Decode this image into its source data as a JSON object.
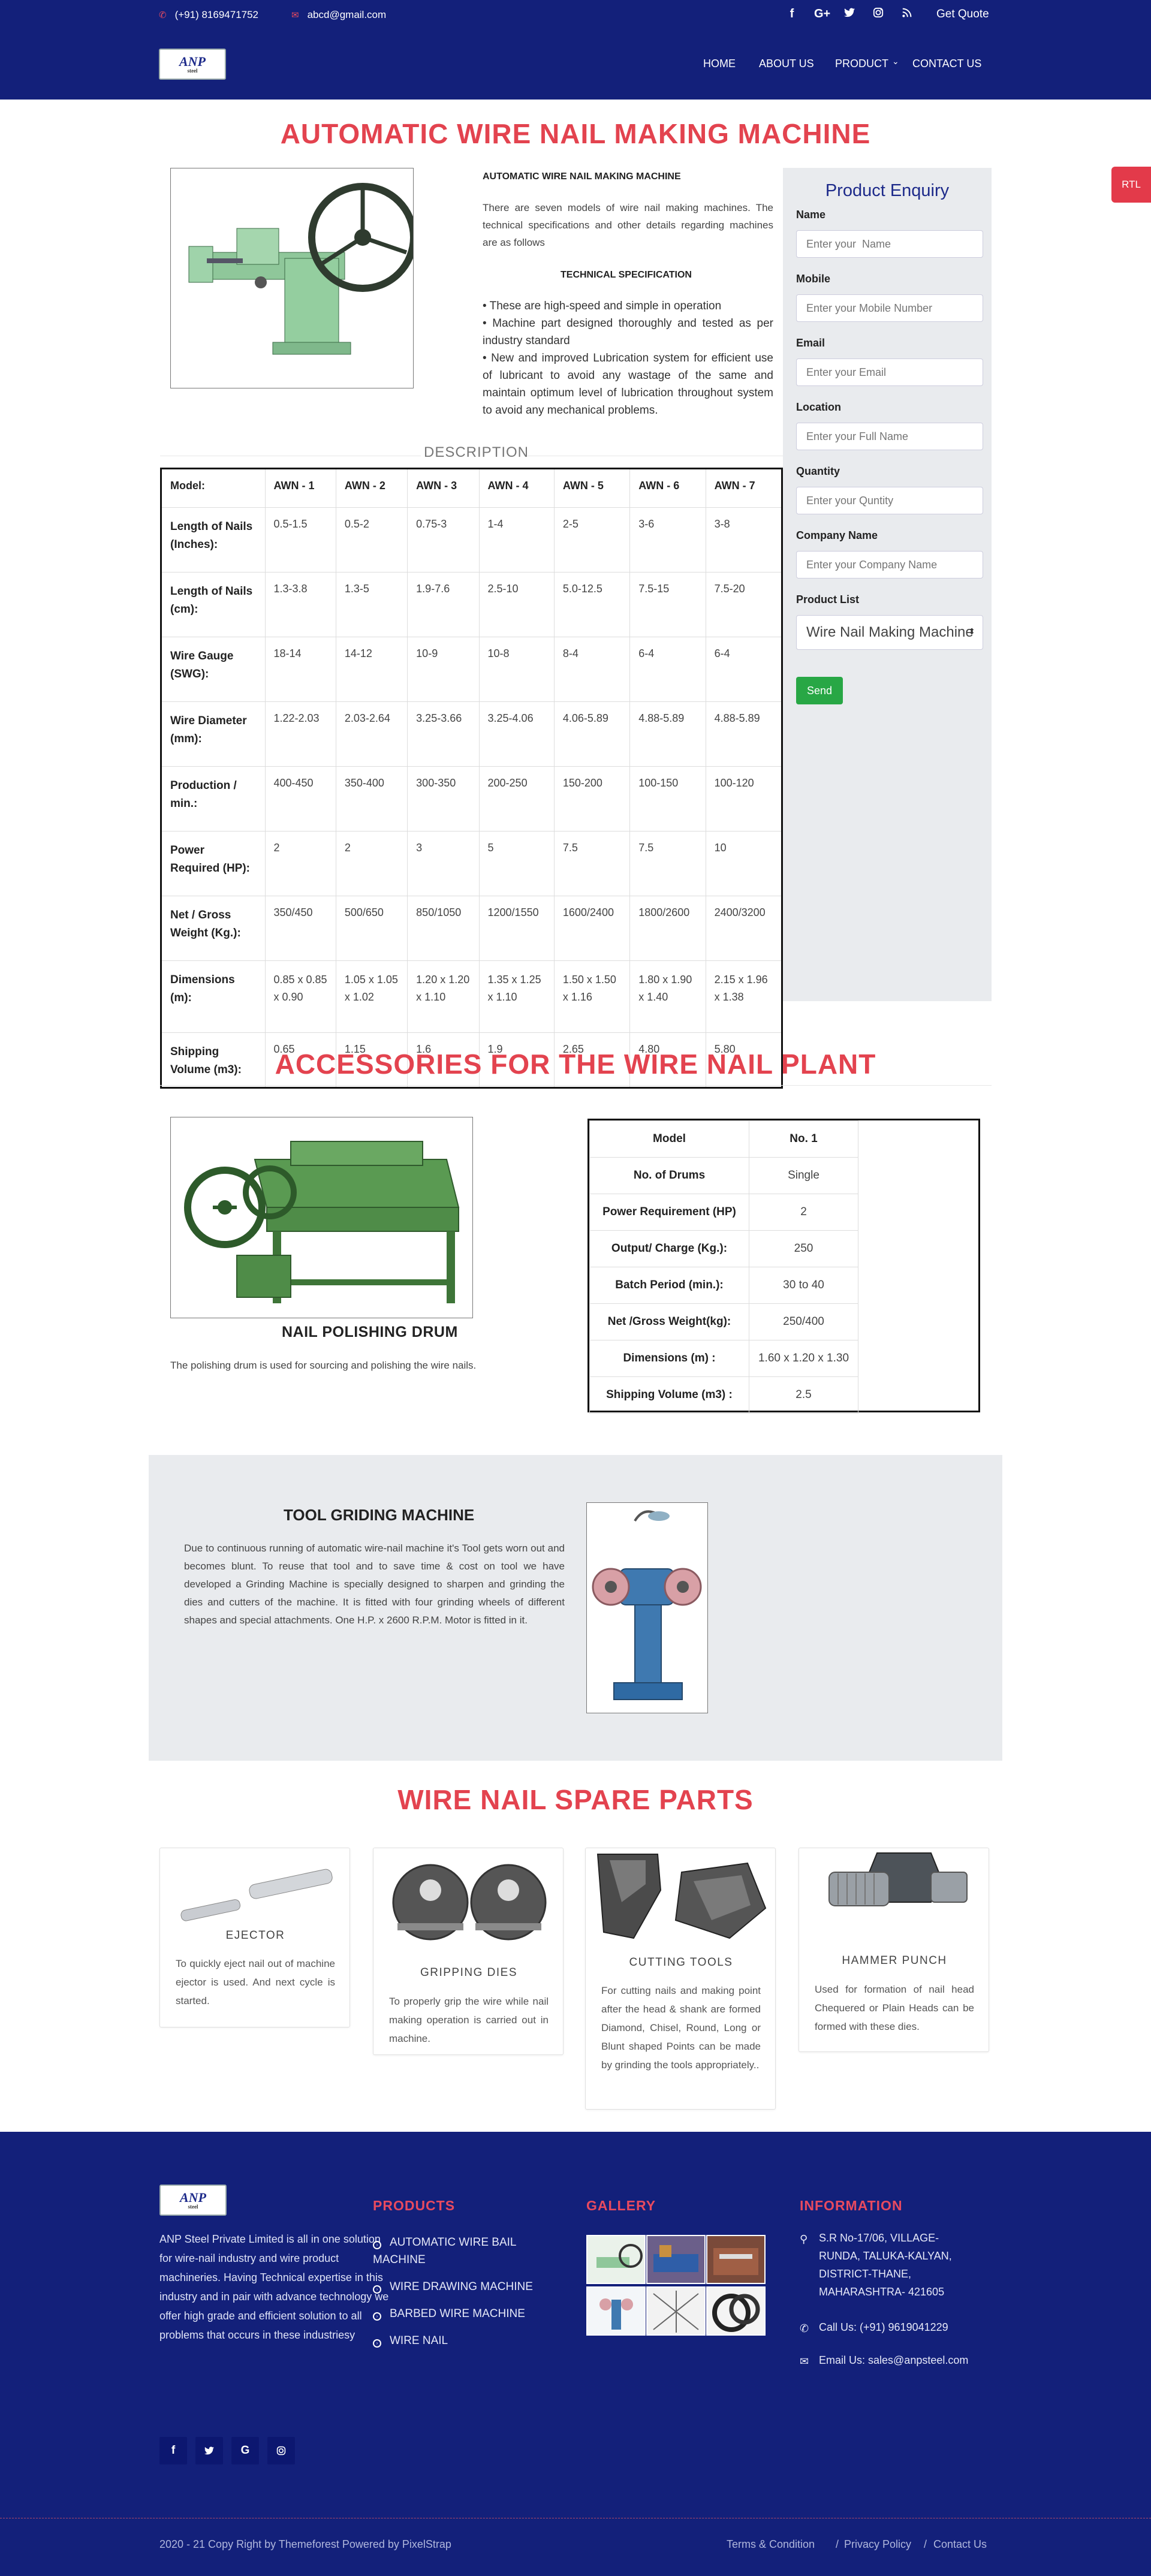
{
  "topbar": {
    "phone": "(+91) 8169471752",
    "email": "abcd@gmail.com",
    "social": [
      "f",
      "G+",
      "twitter",
      "instagram",
      "rss"
    ],
    "get_quote": "Get Quote"
  },
  "nav": {
    "logo_text": "ANP",
    "logo_sub": "steel",
    "items": [
      "HOME",
      "ABOUT US",
      "PRODUCT",
      "CONTACT US"
    ]
  },
  "rtl_tab": "RTL",
  "main": {
    "title": "AUTOMATIC WIRE NAIL MAKING MACHINE",
    "intro_heading": "AUTOMATIC WIRE NAIL MAKING MACHINE",
    "intro_text": "There are seven models of wire nail making machines. The technical specifications and other details regarding machines are as follows",
    "tech_title": "TECHNICAL SPECIFICATION",
    "bullets": [
      "• These are high-speed and simple in operation",
      "• Machine part designed thoroughly and tested as per industry standard",
      "• New and improved Lubrication system for efficient use of lubricant to avoid any wastage of the same and maintain optimum level of lubrication throughout system to avoid any mechanical problems."
    ],
    "description_label": "DESCRIPTION"
  },
  "spec_table": {
    "headers": [
      "Model:",
      "AWN - 1",
      "AWN - 2",
      "AWN - 3",
      "AWN - 4",
      "AWN - 5",
      "AWN - 6",
      "AWN - 7"
    ],
    "rows": [
      {
        "label": "Length of Nails (Inches):",
        "values": [
          "0.5-1.5",
          "0.5-2",
          "0.75-3",
          "1-4",
          "2-5",
          "3-6",
          "3-8"
        ]
      },
      {
        "label": "Length of Nails (cm):",
        "values": [
          "1.3-3.8",
          "1.3-5",
          "1.9-7.6",
          "2.5-10",
          "5.0-12.5",
          "7.5-15",
          "7.5-20"
        ]
      },
      {
        "label": "Wire Gauge (SWG):",
        "values": [
          "18-14",
          "14-12",
          "10-9",
          "10-8",
          "8-4",
          "6-4",
          "6-4"
        ]
      },
      {
        "label": "Wire Diameter (mm):",
        "values": [
          "1.22-2.03",
          "2.03-2.64",
          "3.25-3.66",
          "3.25-4.06",
          "4.06-5.89",
          "4.88-5.89",
          "4.88-5.89"
        ]
      },
      {
        "label": "Production / min.:",
        "values": [
          "400-450",
          "350-400",
          "300-350",
          "200-250",
          "150-200",
          "100-150",
          "100-120"
        ]
      },
      {
        "label": "Power Required (HP):",
        "values": [
          "2",
          "2",
          "3",
          "5",
          "7.5",
          "7.5",
          "10"
        ]
      },
      {
        "label": "Net / Gross Weight (Kg.):",
        "values": [
          "350/450",
          "500/650",
          "850/1050",
          "1200/1550",
          "1600/2400",
          "1800/2600",
          "2400/3200"
        ]
      },
      {
        "label": "Dimensions (m):",
        "values": [
          "0.85 x 0.85 x 0.90",
          "1.05 x 1.05 x 1.02",
          "1.20 x 1.20 x 1.10",
          "1.35 x 1.25 x 1.10",
          "1.50 x 1.50 x 1.16",
          "1.80 x 1.90 x 1.40",
          "2.15 x 1.96 x 1.38"
        ]
      },
      {
        "label": "Shipping Volume (m3):",
        "values": [
          "0.65",
          "1.15",
          "1.6",
          "1.9",
          "2.65",
          "4.80",
          "5.80"
        ]
      }
    ]
  },
  "enquiry": {
    "title": "Product Enquiry",
    "fields": [
      {
        "label": "Name",
        "placeholder": "Enter your  Name"
      },
      {
        "label": "Mobile",
        "placeholder": "Enter your Mobile Number"
      },
      {
        "label": "Email",
        "placeholder": "Enter your Email"
      },
      {
        "label": "Location",
        "placeholder": "Enter your Full Name"
      },
      {
        "label": "Quantity",
        "placeholder": "Enter your Quntity"
      },
      {
        "label": "Company Name",
        "placeholder": "Enter your Company Name"
      }
    ],
    "product_list_label": "Product List",
    "product_list_value": "Wire Nail Making Machine",
    "send": "Send"
  },
  "accessories": {
    "title": "ACCESSORIES FOR THE WIRE NAIL PLANT",
    "drum_title": "NAIL POLISHING DRUM",
    "drum_text": "The polishing drum is used for sourcing and polishing the wire nails.",
    "table": [
      [
        "Model",
        "No. 1"
      ],
      [
        "No. of Drums",
        "Single"
      ],
      [
        "Power Requirement (HP)",
        "2"
      ],
      [
        "Output/ Charge (Kg.):",
        "250"
      ],
      [
        "Batch Period (min.):",
        "30 to 40"
      ],
      [
        "Net /Gross Weight(kg):",
        "250/400"
      ],
      [
        "Dimensions (m) :",
        "1.60 x 1.20 x 1.30"
      ],
      [
        "Shipping Volume (m3) :",
        "2.5"
      ]
    ]
  },
  "grinding": {
    "title": "TOOL GRIDING MACHINE",
    "text": "Due to continuous running of automatic wire-nail machine it's Tool gets worn out and becomes blunt. To reuse that tool and to save time & cost on tool we have developed a Grinding Machine is specially designed to sharpen and grinding the dies and cutters of the machine. It is fitted with four grinding wheels of different shapes and special attachments. One H.P. x 2600 R.P.M. Motor is fitted in it."
  },
  "spare_parts": {
    "title": "WIRE NAIL SPARE PARTS",
    "cards": [
      {
        "name": "EJECTOR",
        "desc": "To quickly eject nail out of machine ejector is used. And next cycle is started."
      },
      {
        "name": "GRIPPING DIES",
        "desc": "To properly grip the wire while nail making operation is carried out in machine."
      },
      {
        "name": "CUTTING TOOLS",
        "desc": "For cutting nails and making point after the head & shank are formed Diamond, Chisel, Round, Long or Blunt shaped Points can be made by grinding the tools appropriately.."
      },
      {
        "name": "HAMMER PUNCH",
        "desc": "Used for formation of nail head Chequered or Plain Heads can be formed with these dies."
      }
    ]
  },
  "footer": {
    "about": "ANP Steel Private Limited is all in one solution for wire-nail industry and wire product machineries. Having Technical expertise in this industry and in pair with advance technology we offer high grade and efficient solution to all problems that occurs in these industriesy",
    "social": [
      "f",
      "twitter",
      "G",
      "instagram"
    ],
    "products_title": "PRODUCTS",
    "products": [
      "AUTOMATIC WIRE BAIL MACHINE",
      "WIRE DRAWING MACHINE",
      "BARBED WIRE MACHINE",
      "WIRE NAIL"
    ],
    "gallery_title": "GALLERY",
    "info_title": "INFORMATION",
    "address": "S.R No-17/06, VILLAGE- RUNDA, TALUKA-KALYAN, DISTRICT-THANE, MAHARASHTRA- 421605",
    "call": "Call Us: (+91) 9619041229",
    "email": "Email Us: sales@anpsteel.com",
    "copyright": "2020 - 21 Copy Right by Themeforest Powered by PixelStrap",
    "bottom_links": [
      "Terms & Condition",
      "/",
      "Privacy Policy",
      "/",
      "Contact Us"
    ]
  },
  "colors": {
    "navy": "#13207a",
    "accent_red": "#e3434f",
    "send_green": "#28a745",
    "panel_gray": "#e9ebee"
  }
}
